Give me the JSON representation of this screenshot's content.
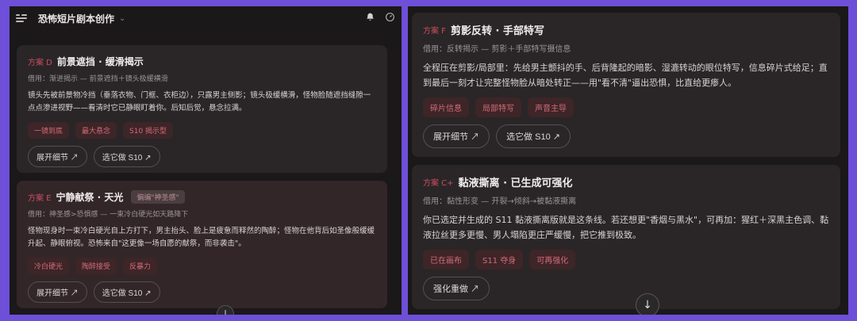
{
  "left": {
    "app_title": "恐怖短片剧本创作",
    "cards": [
      {
        "label": "方案 D",
        "title": "前景遮挡 · 缓滑揭示",
        "source": "借用：渐进揭示 — 前景遮挡＋镜头极缓横滑",
        "body": "镜头先被前景物冷挡（垂落衣物、门框、衣柜边），只露男主侧影；镜头极缓横滑，怪物脸随遮挡缝隙一点点渗进视野——看清时它已静眼盯着你。后知后觉，悬念拉满。",
        "tags": [
          "一镜到底",
          "最大悬念",
          "S10 揭示型"
        ],
        "actions": [
          "展开细节 ↗",
          "选它做 S10 ↗"
        ]
      },
      {
        "label": "方案 E",
        "title": "宁静献祭 · 天光",
        "badge": "偏编\"神圣感\"",
        "source": "借用：神圣感>恐惧感 — 一束冷白硬光如天路降下",
        "body": "怪物现身时一束冷白硬光自上方打下，男主抬头、脸上是疲惫而释然的陶醉；怪物在他背后如圣像般缓缓升起、静眼俯视。恐怖来自\"这更像一场自愿的献祭，而非袭击\"。",
        "tags": [
          "冷白硬光",
          "陶醉接受",
          "反暴力"
        ],
        "actions": [
          "展开细节 ↗",
          "选它做 S10 ↗"
        ]
      }
    ]
  },
  "right": {
    "cards": [
      {
        "label": "方案 F",
        "title": "剪影反转 · 手部特写",
        "source": "借用：反转揭示 — 剪影＋手部特写摄信息",
        "body": "全程压在剪影/局部里：先给男主颤抖的手、后背隆起的暗影、湿漉转动的眼位特写，信息碎片式给足；直到最后一刻才让完整怪物脸从暗处转正——用\"看不清\"逼出恐惧，比直给更瘆人。",
        "tags": [
          "碎片信息",
          "局部特写",
          "声音主导"
        ],
        "actions": [
          "展开细节 ↗",
          "选它做 S10 ↗"
        ]
      },
      {
        "label": "方案 C+",
        "title": "黏液撕离 · 已生成可强化",
        "source": "借用：黏性形变 — 开裂→倾斜→被黏液撕离",
        "body": "你已选定并生成的 S11 黏液撕离版就是这条线。若还想更\"香烟与黑水\"，可再加：猩红＋深黑主色调、黏液拉丝更多更慢、男人塌陷更庄严缓慢，把它推到极致。",
        "tags": [
          "已在画布",
          "S11 夺身",
          "可再强化"
        ],
        "actions": [
          "强化重做 ↗"
        ]
      }
    ]
  }
}
